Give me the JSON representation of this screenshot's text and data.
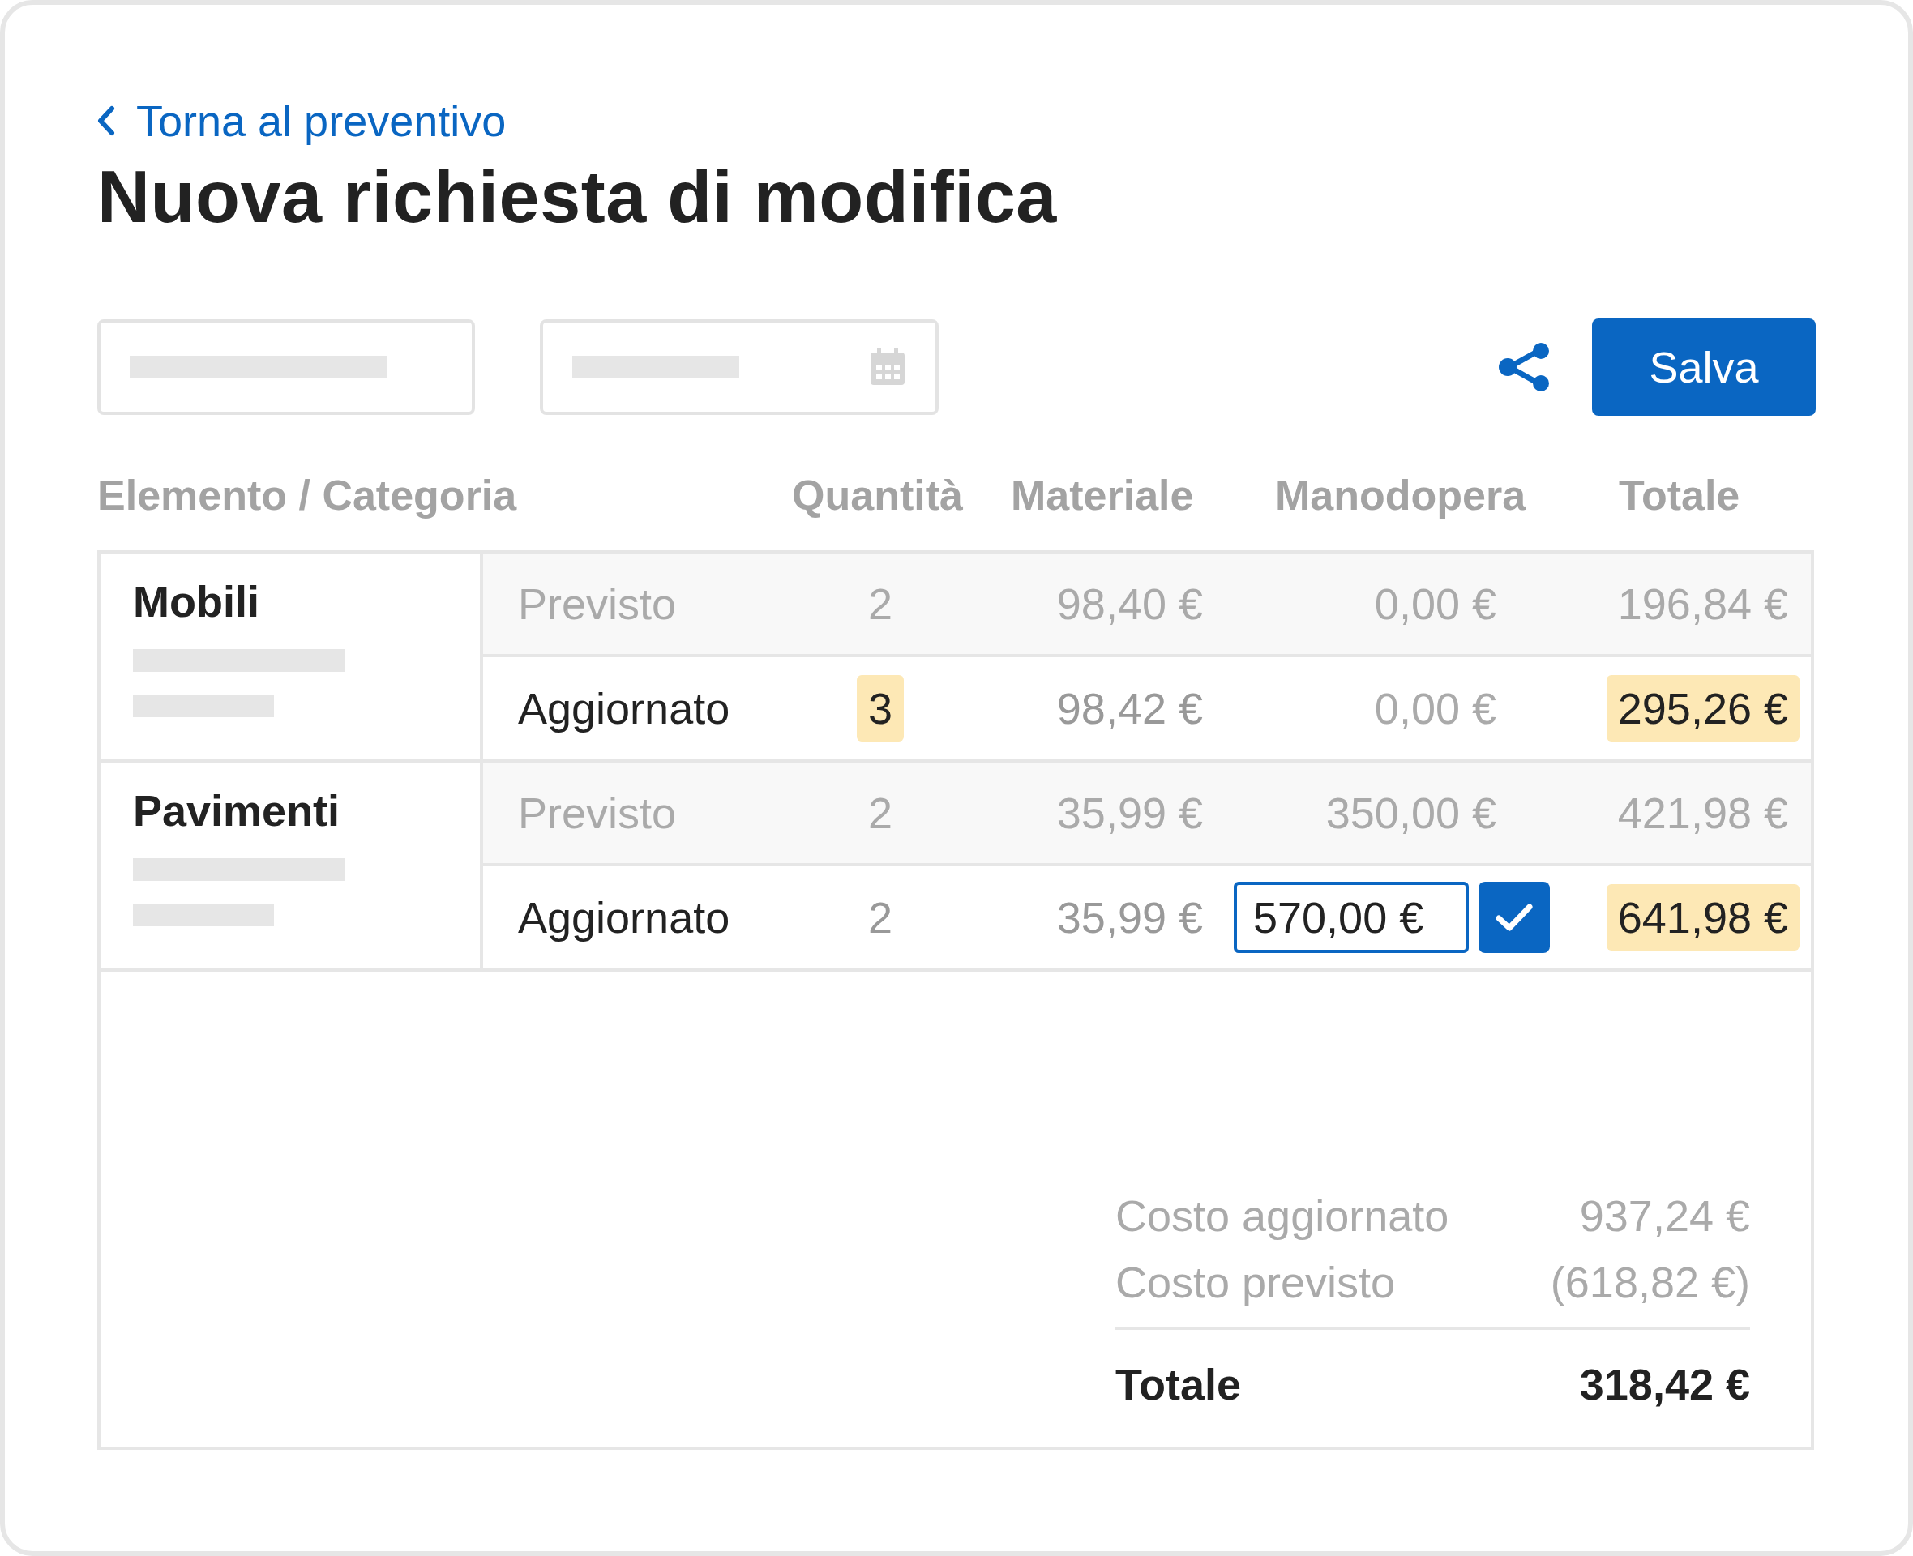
{
  "back_link": {
    "label": "Torna al preventivo"
  },
  "title": "Nuova richiesta di modifica",
  "toolbar": {
    "save_button": "Salva"
  },
  "table": {
    "columns": [
      "Elemento / Categoria",
      "Quantità",
      "Materiale",
      "Manodopera",
      "Totale"
    ],
    "groups": [
      {
        "name": "Mobili",
        "rows": [
          {
            "kind": "previsto",
            "label": "Previsto",
            "quantity": {
              "value": "2",
              "highlighted": false
            },
            "material": "98,40 €",
            "labor": {
              "value": "0,00 €",
              "editing": false
            },
            "total": {
              "value": "196,84 €",
              "highlighted": false
            }
          },
          {
            "kind": "aggiornato",
            "label": "Aggiornato",
            "quantity": {
              "value": "3",
              "highlighted": true
            },
            "material": "98,42 €",
            "labor": {
              "value": "0,00 €",
              "editing": false
            },
            "total": {
              "value": "295,26 €",
              "highlighted": true
            }
          }
        ]
      },
      {
        "name": "Pavimenti",
        "rows": [
          {
            "kind": "previsto",
            "label": "Previsto",
            "quantity": {
              "value": "2",
              "highlighted": false
            },
            "material": "35,99 €",
            "labor": {
              "value": "350,00 €",
              "editing": false
            },
            "total": {
              "value": "421,98 €",
              "highlighted": false
            }
          },
          {
            "kind": "aggiornato",
            "label": "Aggiornato",
            "quantity": {
              "value": "2",
              "highlighted": false
            },
            "material": "35,99 €",
            "labor": {
              "value": "570,00 €",
              "editing": true
            },
            "total": {
              "value": "641,98 €",
              "highlighted": true
            }
          }
        ]
      }
    ]
  },
  "summary": {
    "lines": [
      {
        "label": "Costo aggiornato",
        "value": "937,24 €"
      },
      {
        "label": "Costo previsto",
        "value": "(618,82 €)"
      }
    ],
    "total": {
      "label": "Totale",
      "value": "318,42 €"
    }
  }
}
